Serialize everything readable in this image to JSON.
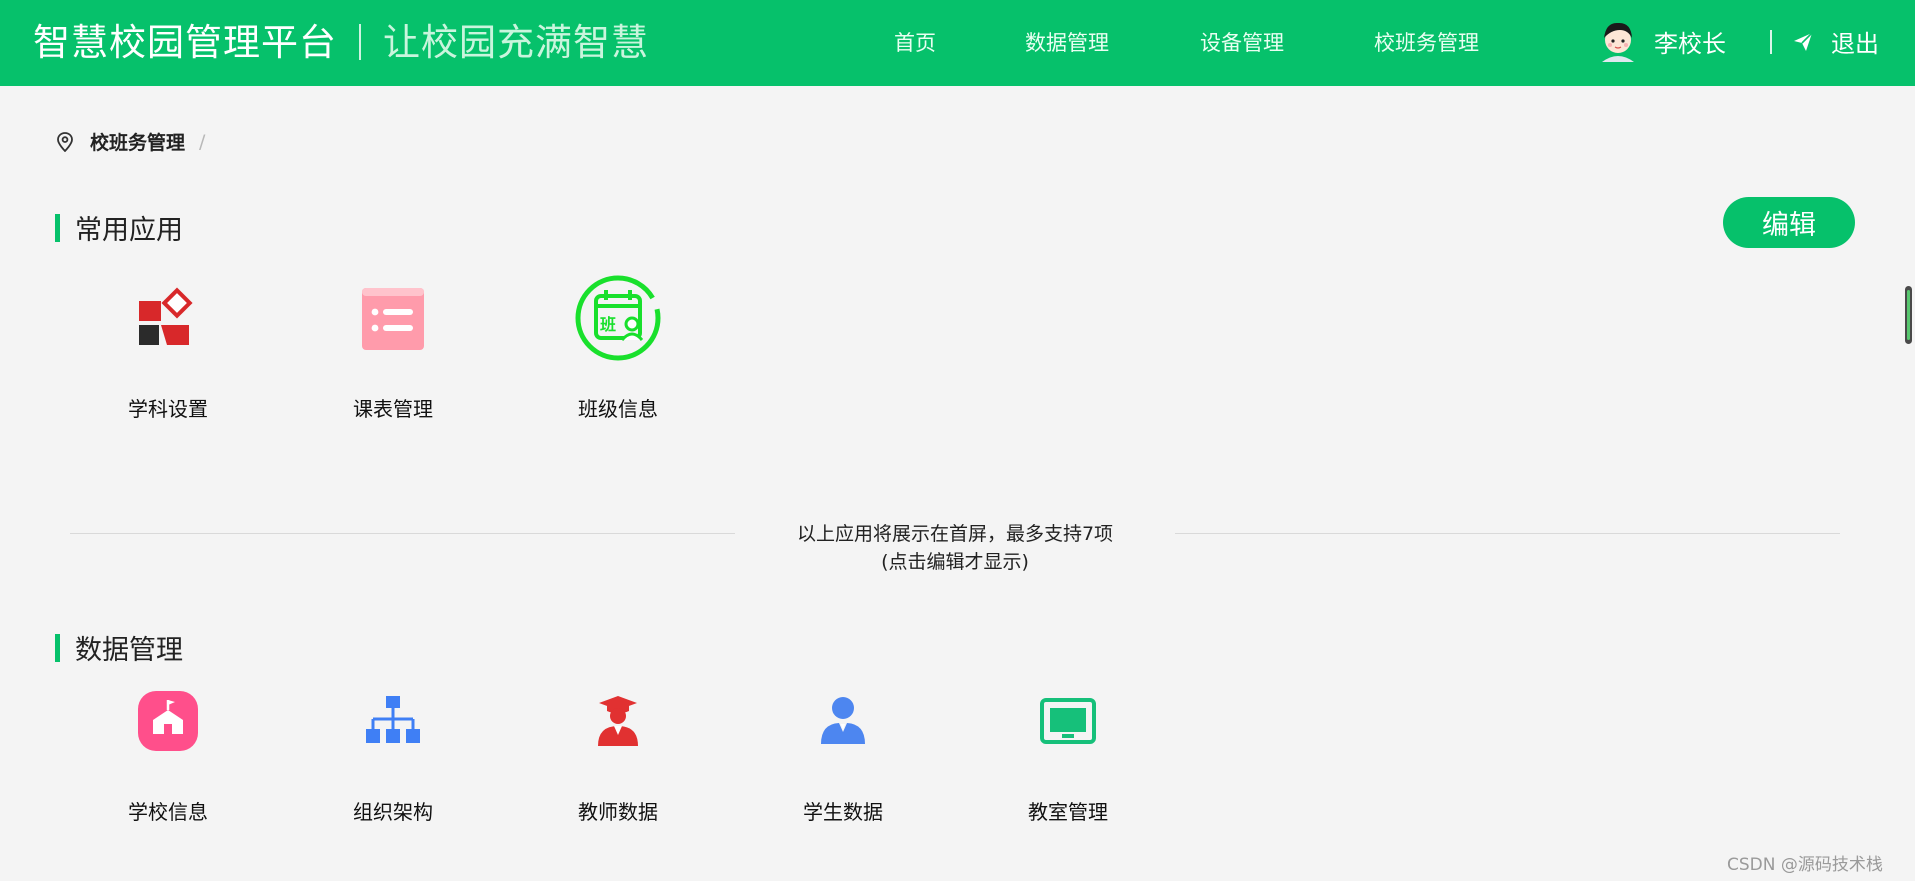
{
  "header": {
    "brand": "智慧校园管理平台",
    "slogan": "让校园充满智慧",
    "nav": [
      "首页",
      "数据管理",
      "设备管理",
      "校班务管理"
    ],
    "user_name": "李校长",
    "logout": "退出",
    "bg_color": "#06c16b"
  },
  "breadcrumb": {
    "current": "校班务管理",
    "separator": "/"
  },
  "common_apps": {
    "title": "常用应用",
    "edit_label": "编辑",
    "items": [
      {
        "label": "学科设置",
        "icon": "subject-settings-icon"
      },
      {
        "label": "课表管理",
        "icon": "timetable-icon"
      },
      {
        "label": "班级信息",
        "icon": "class-info-icon"
      }
    ]
  },
  "divider": {
    "line1": "以上应用将展示在首屏，最多支持7项",
    "line2": "(点击编辑才显示)"
  },
  "data_management": {
    "title": "数据管理",
    "items": [
      {
        "label": "学校信息",
        "icon": "school-icon"
      },
      {
        "label": "组织架构",
        "icon": "org-chart-icon"
      },
      {
        "label": "教师数据",
        "icon": "teacher-icon"
      },
      {
        "label": "学生数据",
        "icon": "student-icon"
      },
      {
        "label": "教室管理",
        "icon": "classroom-icon"
      }
    ]
  },
  "watermark": "CSDN @源码技术栈"
}
